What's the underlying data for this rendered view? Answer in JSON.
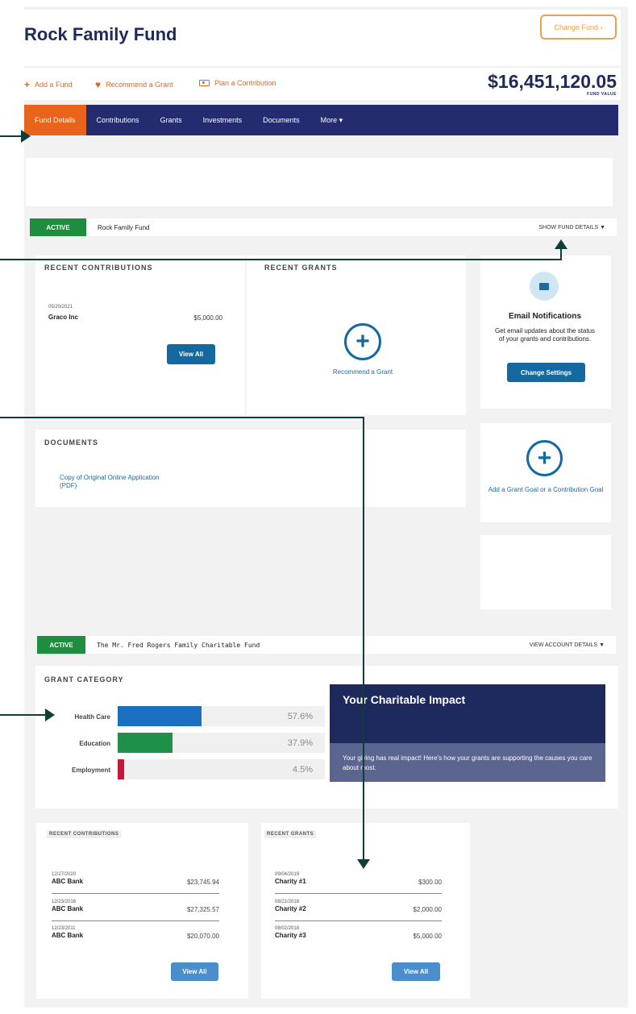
{
  "header": {
    "title": "Rock Family Fund",
    "change_fund": "Change Fund ›",
    "fund_value": "$16,451,120.05",
    "fund_value_label": "FUND VALUE",
    "actions": [
      {
        "icon": "plus-icon",
        "label": "Add a Fund"
      },
      {
        "icon": "heart-icon",
        "label": "Recommend a Grant"
      },
      {
        "icon": "money-icon",
        "label": "Plan a Contribution"
      }
    ]
  },
  "nav": {
    "tabs": [
      "Fund Details",
      "Contributions",
      "Grants",
      "Investments",
      "Documents",
      "More ▾"
    ],
    "active": "Fund Details"
  },
  "fund_panel": {
    "status": "ACTIVE",
    "name": "Rock Family Fund",
    "details_toggle": "SHOW FUND DETAILS",
    "recent_contributions": {
      "heading": "RECENT CONTRIBUTIONS",
      "items": [
        {
          "date": "05/20/2021",
          "name": "Graco Inc",
          "amount": "$5,000.00"
        }
      ],
      "view_all": "View All"
    },
    "recent_grants": {
      "heading": "RECENT GRANTS",
      "action": "Recommend a Grant"
    },
    "email": {
      "title": "Email Notifications",
      "text": "Get email updates about the status of your grants and contributions.",
      "button": "Change Settings"
    },
    "documents": {
      "heading": "DOCUMENTS",
      "link": "Copy of Original Online Application (PDF)"
    },
    "goal": {
      "action": "Add a Grant Goal or a Contribution Goal"
    }
  },
  "account_panel": {
    "status": "ACTIVE",
    "name": "The Mr. Fred Rogers Family Charitable Fund",
    "details_toggle": "VIEW ACCOUNT DETAILS",
    "grant_category": {
      "heading": "GRANT CATEGORY",
      "categories": [
        {
          "label": "Health Care",
          "pct": "57.6%",
          "value": 57.6,
          "color": "#1a6fc0"
        },
        {
          "label": "Education",
          "pct": "37.9%",
          "value": 37.9,
          "color": "#1e9048"
        },
        {
          "label": "Employment",
          "pct": "4.5%",
          "value": 4.5,
          "color": "#c8173a"
        }
      ]
    },
    "impact": {
      "title": "Your Charitable Impact",
      "text": "Your giving has real impact! Here's how your grants are supporting the causes you care about most."
    },
    "recent_contributions": {
      "heading": "RECENT CONTRIBUTIONS",
      "items": [
        {
          "date": "12/27/2020",
          "name": "ABC Bank",
          "amount": "$23,745.94"
        },
        {
          "date": "12/23/2016",
          "name": "ABC Bank",
          "amount": "$27,325.57"
        },
        {
          "date": "12/23/2011",
          "name": "ABC Bank",
          "amount": "$20,070.00"
        }
      ],
      "view_all": "View All"
    },
    "recent_grants": {
      "heading": "RECENT GRANTS",
      "items": [
        {
          "date": "09/04/2019",
          "name": "Charity #1",
          "amount": "$300.00"
        },
        {
          "date": "08/21/2018",
          "name": "Charity #2",
          "amount": "$2,000.00"
        },
        {
          "date": "08/02/2018",
          "name": "Charity #3",
          "amount": "$5,000.00"
        }
      ],
      "view_all": "View All"
    }
  }
}
